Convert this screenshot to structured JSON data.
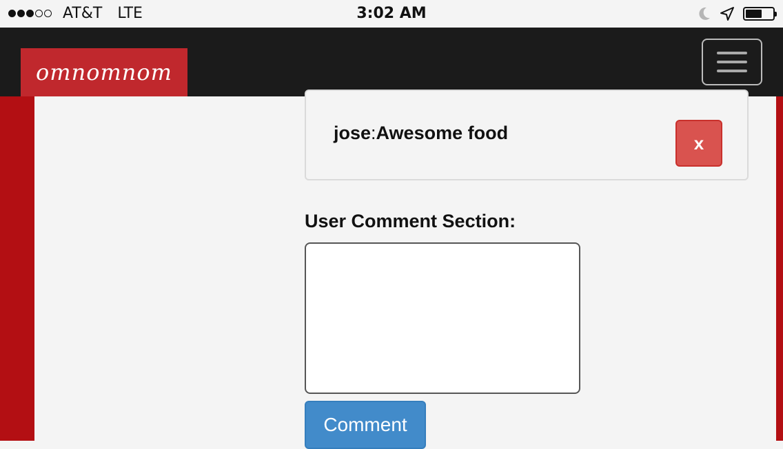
{
  "status_bar": {
    "signal_bars_filled": 3,
    "signal_bars_total": 5,
    "carrier": "AT&T",
    "network": "LTE",
    "time": "3:02 AM",
    "icons": [
      "moon-icon",
      "location-arrow-icon",
      "battery-icon"
    ],
    "battery_level": 0.6
  },
  "navbar": {
    "brand": "omnomnom",
    "brand_color": "#c0282d",
    "background": "#1b1b1b",
    "menu_icon": "hamburger-menu-icon"
  },
  "comments": [
    {
      "user": "jose",
      "separator": ":",
      "text": "Awesome food",
      "delete_label": "x"
    }
  ],
  "comment_form": {
    "label": "User Comment Section:",
    "value": "",
    "submit_label": "Comment"
  },
  "colors": {
    "side_accent": "#b30f13",
    "danger": "#d9534f",
    "primary": "#428bca"
  }
}
